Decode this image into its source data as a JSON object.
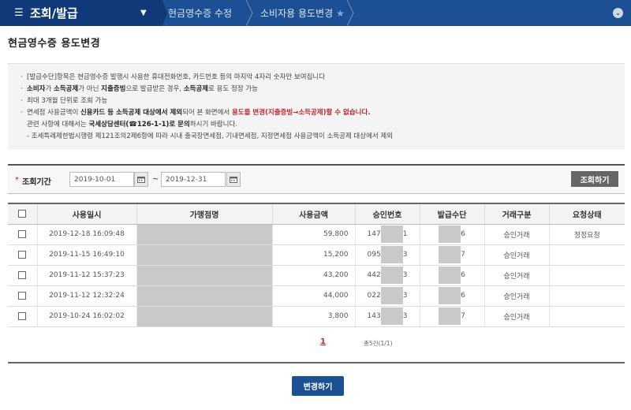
{
  "nav": {
    "menu_title": "조회/발급",
    "crumb1": "현금영수증 수정",
    "crumb2": "소비자용 용도변경"
  },
  "page_title": "현금영수증 용도변경",
  "info": {
    "line1": "[발급수단]항목은 현금영수증 발행시 사용한 휴대전화번호, 카드번호 등의 마지막 4자리 숫자만 보여집니다",
    "line2a": "소비자",
    "line2b": "가 ",
    "line2c": "소득공제",
    "line2d": "가 아닌 ",
    "line2e": "지출증빙",
    "line2f": "으로 발급받은 경우, ",
    "line2g": "소득공제",
    "line2h": "로 용도 정정 가능",
    "line3": "최대 3개월 단위로 조회 가능",
    "line4a": "면세점 사용금액이 ",
    "line4b": "신용카드 등 소득공제 대상에서 제외",
    "line4c": "되어 본 화면에서 ",
    "line4d": "용도를 변경(지출증빙→소득공제)할 수 없습니다.",
    "line5a": "관련 사항에 대해서는 ",
    "line5b": "국세상담센터(☎126-1-1)로 문의",
    "line5c": "하시기 바랍니다.",
    "line6": "- 조세특례제한법시행령 제121조의2제6항에 따라 시내 출국장면세점, 기내면세점, 지정면세점 사용금액이 소득공제 대상에서 제외"
  },
  "search": {
    "label": "조회기간",
    "start_date": "2019-10-01",
    "end_date": "2019-12-31",
    "tilde": "~",
    "query_button": "조회하기"
  },
  "table": {
    "headers": [
      "사용일시",
      "가맹점명",
      "사용금액",
      "승인번호",
      "발급수단",
      "거래구분",
      "요청상태"
    ],
    "rows": [
      {
        "datetime": "2019-12-18 16:09:48",
        "amount": "59,800",
        "approval_pre": "147",
        "approval_suf": "1",
        "means": "6",
        "type": "승인거래",
        "status": "정정요청"
      },
      {
        "datetime": "2019-11-15 16:49:10",
        "amount": "15,200",
        "approval_pre": "095",
        "approval_suf": "3",
        "means": "7",
        "type": "승인거래",
        "status": ""
      },
      {
        "datetime": "2019-11-12 15:37:23",
        "amount": "43,200",
        "approval_pre": "442",
        "approval_suf": "3",
        "means": "6",
        "type": "승인거래",
        "status": ""
      },
      {
        "datetime": "2019-11-12 12:32:24",
        "amount": "44,000",
        "approval_pre": "022",
        "approval_suf": "3",
        "means": "6",
        "type": "승인거래",
        "status": ""
      },
      {
        "datetime": "2019-10-24 16:02:02",
        "amount": "3,800",
        "approval_pre": "143",
        "approval_suf": "3",
        "means": "7",
        "type": "승인거래",
        "status": ""
      }
    ]
  },
  "pager": {
    "current": "1",
    "total": "총5건(1/1)"
  },
  "change_button": "변경하기",
  "colors": {
    "nav_bg": "#1d4f95",
    "menu_bg": "#0f3978",
    "accent_red": "#c0282d"
  }
}
